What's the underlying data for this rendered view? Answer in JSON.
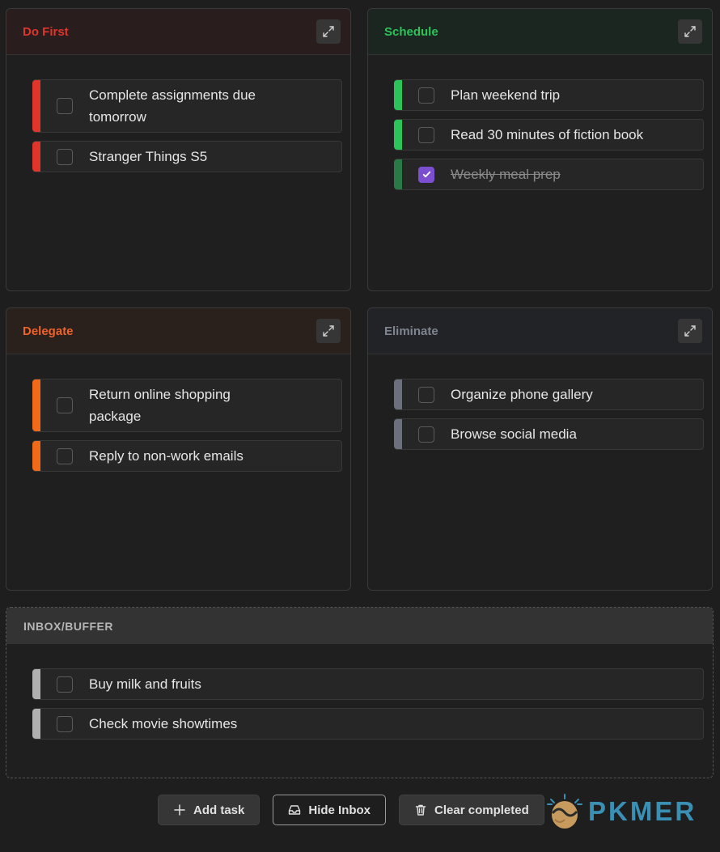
{
  "quadrants": {
    "do_first": {
      "title": "Do First",
      "title_color": "#e0352b",
      "header_bg": "#2a1d1d",
      "bar_color": "#e0352b",
      "tasks": [
        {
          "text": "Complete assignments due tomorrow",
          "done": false
        },
        {
          "text": "Stranger Things S5",
          "done": false
        }
      ]
    },
    "schedule": {
      "title": "Schedule",
      "title_color": "#2cc35a",
      "header_bg": "#1c2620",
      "bar_color": "#2cc35a",
      "tasks": [
        {
          "text": "Plan weekend trip",
          "done": false
        },
        {
          "text": "Read 30 minutes of fiction book",
          "done": false
        },
        {
          "text": "Weekly meal prep",
          "done": true
        }
      ]
    },
    "delegate": {
      "title": "Delegate",
      "title_color": "#f0622a",
      "header_bg": "#2a201c",
      "bar_color": "#f06a1a",
      "tasks": [
        {
          "text": "Return online shopping package",
          "done": false
        },
        {
          "text": "Reply to non-work emails",
          "done": false
        }
      ]
    },
    "eliminate": {
      "title": "Eliminate",
      "title_color": "#7f8590",
      "header_bg": "#222326",
      "bar_color": "#6c707c",
      "tasks": [
        {
          "text": "Organize phone gallery",
          "done": false
        },
        {
          "text": "Browse social media",
          "done": false
        }
      ]
    }
  },
  "inbox": {
    "title": "INBOX/BUFFER",
    "bar_color": "#b0b0b0",
    "tasks": [
      {
        "text": "Buy milk and fruits",
        "done": false
      },
      {
        "text": "Check movie showtimes",
        "done": false
      }
    ]
  },
  "footer": {
    "add_task": "Add task",
    "hide_inbox": "Hide Inbox",
    "clear_completed": "Clear completed"
  },
  "watermark": {
    "text": "PKMER"
  },
  "icons": {
    "expand": "expand-icon",
    "plus": "plus-icon",
    "inbox": "inbox-icon",
    "trash": "trash-icon",
    "check": "check-icon"
  }
}
